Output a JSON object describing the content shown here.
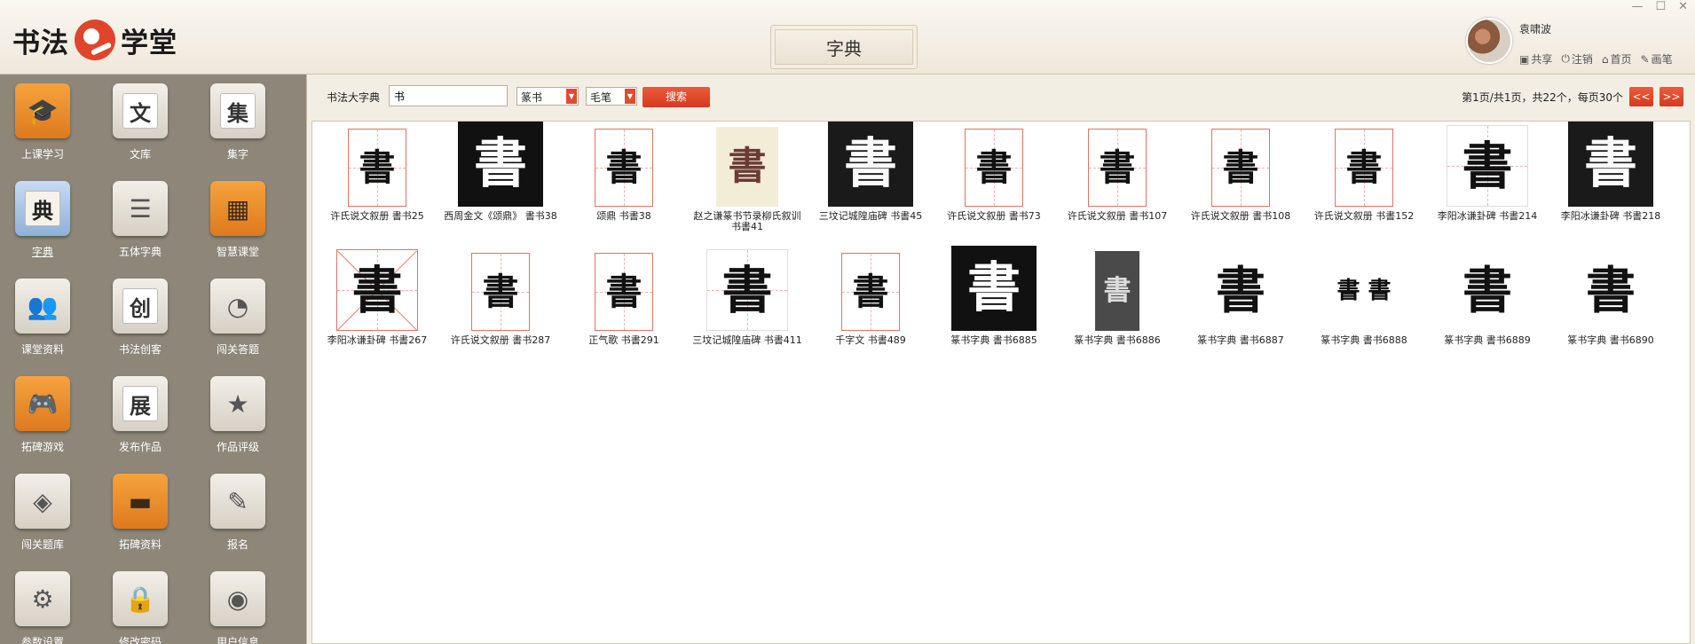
{
  "app": {
    "logo_left": "书法",
    "logo_right": "学堂",
    "page_title": "字典",
    "window_controls": [
      "—",
      "☐",
      "✕"
    ]
  },
  "user": {
    "name": "袁啸波",
    "actions": [
      {
        "icon": "image-icon",
        "glyph": "▣",
        "label": "共享"
      },
      {
        "icon": "power-icon",
        "glyph": "⏻",
        "label": "注销"
      },
      {
        "icon": "home-icon",
        "glyph": "⌂",
        "label": "首页"
      },
      {
        "icon": "pen-icon",
        "glyph": "✎",
        "label": "画笔"
      }
    ]
  },
  "sidebar": {
    "items": [
      {
        "label": "上课学习",
        "style": "orange",
        "glyph": "🎓",
        "icon": "graduation-cap-icon"
      },
      {
        "label": "文库",
        "style": "grey",
        "glyph": "文",
        "icon": "library-icon"
      },
      {
        "label": "集字",
        "style": "grey",
        "glyph": "集",
        "icon": "collect-chars-icon"
      },
      {
        "label": "字典",
        "style": "blue",
        "glyph": "典",
        "icon": "dictionary-icon",
        "active": true
      },
      {
        "label": "五体字典",
        "style": "grey",
        "glyph": "☰",
        "icon": "five-styles-icon"
      },
      {
        "label": "智慧课堂",
        "style": "orange",
        "glyph": "▦",
        "icon": "smart-classroom-icon"
      },
      {
        "label": "课堂资料",
        "style": "grey",
        "glyph": "👥",
        "icon": "class-materials-icon"
      },
      {
        "label": "书法创客",
        "style": "grey",
        "glyph": "创",
        "icon": "maker-icon"
      },
      {
        "label": "闯关答题",
        "style": "grey",
        "glyph": "◔",
        "icon": "quiz-icon"
      },
      {
        "label": "拓碑游戏",
        "style": "orange",
        "glyph": "🎮",
        "icon": "game-icon"
      },
      {
        "label": "发布作品",
        "style": "grey",
        "glyph": "展",
        "icon": "publish-icon"
      },
      {
        "label": "作品评级",
        "style": "grey",
        "glyph": "★",
        "icon": "rating-icon"
      },
      {
        "label": "闯关题库",
        "style": "grey",
        "glyph": "◈",
        "icon": "question-bank-icon"
      },
      {
        "label": "拓碑资料",
        "style": "orange",
        "glyph": "▬",
        "icon": "book-icon"
      },
      {
        "label": "报名",
        "style": "grey",
        "glyph": "✎",
        "icon": "signup-icon"
      },
      {
        "label": "参数设置",
        "style": "grey",
        "glyph": "⚙",
        "icon": "settings-icon"
      },
      {
        "label": "修改密码",
        "style": "grey",
        "glyph": "🔒",
        "icon": "lock-icon"
      },
      {
        "label": "用户信息",
        "style": "grey",
        "glyph": "◉",
        "icon": "user-info-icon"
      }
    ]
  },
  "toolbar": {
    "label": "书法大字典",
    "query": "书",
    "script_select": "篆书",
    "tool_select": "毛笔",
    "search_label": "搜索",
    "page_info": "第1页/共1页，共22个，每页30个",
    "prev_label": "<<",
    "next_label": ">>"
  },
  "results": [
    {
      "caption": "许氏说文叙册  書书25",
      "glyph": "書",
      "bg": "white",
      "border": "red",
      "grid": true
    },
    {
      "caption": "西周金文《颂鼎》 書书38",
      "glyph": "書",
      "bg": "black",
      "border": "none",
      "grid": false
    },
    {
      "caption": "颂鼎  书書38",
      "glyph": "書",
      "bg": "white",
      "border": "red",
      "grid": true
    },
    {
      "caption": "赵之谦篆书节录柳氏叙训 书書41",
      "glyph": "書",
      "bg": "paper",
      "border": "none",
      "grid": false
    },
    {
      "caption": "三坟记城隍庙碑  书書45",
      "glyph": "書",
      "bg": "rub",
      "border": "none",
      "grid": false
    },
    {
      "caption": "许氏说文叙册  書书73",
      "glyph": "書",
      "bg": "white",
      "border": "red",
      "grid": true
    },
    {
      "caption": "许氏说文叙册  書书107",
      "glyph": "書",
      "bg": "white",
      "border": "red",
      "grid": true
    },
    {
      "caption": "许氏说文叙册  書书108",
      "glyph": "書",
      "bg": "white",
      "border": "red",
      "grid": true
    },
    {
      "caption": "许氏说文叙册  书書152",
      "glyph": "書",
      "bg": "white",
      "border": "red",
      "grid": true
    },
    {
      "caption": "李阳冰谦卦碑  书書214",
      "glyph": "書",
      "bg": "white",
      "border": "grey",
      "grid": true
    },
    {
      "caption": "李阳冰谦卦碑  书書218",
      "glyph": "書",
      "bg": "rub",
      "border": "none",
      "grid": false
    },
    {
      "caption": "李阳冰谦卦碑  书書267",
      "glyph": "書",
      "bg": "white",
      "border": "red",
      "grid": "diag"
    },
    {
      "caption": "许氏说文叙册  書书287",
      "glyph": "書",
      "bg": "white",
      "border": "red",
      "grid": true
    },
    {
      "caption": "正气歌  书書291",
      "glyph": "書",
      "bg": "white",
      "border": "red",
      "grid": true
    },
    {
      "caption": "三坟记城隍庙碑  书書411",
      "glyph": "書",
      "bg": "white",
      "border": "grey",
      "grid": true
    },
    {
      "caption": "千字文  书書489",
      "glyph": "書",
      "bg": "white",
      "border": "red",
      "grid": true
    },
    {
      "caption": "篆书字典  書书6885",
      "glyph": "書",
      "bg": "black",
      "border": "none",
      "grid": false
    },
    {
      "caption": "篆书字典  書书6886",
      "glyph": "書",
      "bg": "grey",
      "border": "none",
      "grid": false
    },
    {
      "caption": "篆书字典  書书6887",
      "glyph": "書",
      "bg": "white",
      "border": "none",
      "grid": false
    },
    {
      "caption": "篆书字典  書书6888",
      "glyph": "書 書",
      "bg": "white",
      "border": "none",
      "grid": false
    },
    {
      "caption": "篆书字典  書书6889",
      "glyph": "書",
      "bg": "white",
      "border": "none",
      "grid": false
    },
    {
      "caption": "篆书字典  書书6890",
      "glyph": "書",
      "bg": "white",
      "border": "none",
      "grid": false
    }
  ]
}
